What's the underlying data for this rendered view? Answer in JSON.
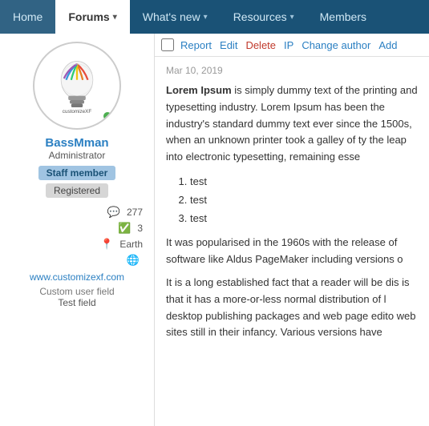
{
  "nav": {
    "items": [
      {
        "label": "Home",
        "active": false
      },
      {
        "label": "Forums",
        "active": true,
        "has_arrow": true
      },
      {
        "label": "What's new",
        "active": false,
        "has_arrow": true
      },
      {
        "label": "Resources",
        "active": false,
        "has_arrow": true
      },
      {
        "label": "Members",
        "active": false
      }
    ]
  },
  "sidebar": {
    "avatar_text": "customizeXF",
    "username": "BassMman",
    "role": "Administrator",
    "badge_staff": "Staff member",
    "badge_registered": "Registered",
    "stats": [
      {
        "icon": "💬",
        "value": "277"
      },
      {
        "icon": "✅",
        "value": "3"
      },
      {
        "icon": "📍",
        "value": "Earth"
      },
      {
        "icon": "🌐",
        "value": ""
      }
    ],
    "site_link": "www.customizexf.com",
    "custom_field_label": "Custom user field",
    "custom_field_value": "Test field"
  },
  "post": {
    "date": "Mar 10, 2019",
    "actions": {
      "report": "Report",
      "edit": "Edit",
      "delete": "Delete",
      "ip": "IP",
      "change_author": "Change author",
      "add": "Add"
    },
    "body_bold": "Lorem Ipsum",
    "body_text1": " is simply dummy text of the printing and typesetting industry. Lorem Ipsum has been the industry's standard dummy text ever since the 1500s, when an unknown printer took a galley of ty the leap into electronic typesetting, remaining esse",
    "list_items": [
      "test",
      "test",
      "test"
    ],
    "body_text2": "It was popularised in the 1960s with the release of software like Aldus PageMaker including versions o",
    "body_text3": "It is a long established fact that a reader will be dis is that it has a more-or-less normal distribution of l desktop publishing packages and web page edito web sites still in their infancy. Various versions have"
  }
}
